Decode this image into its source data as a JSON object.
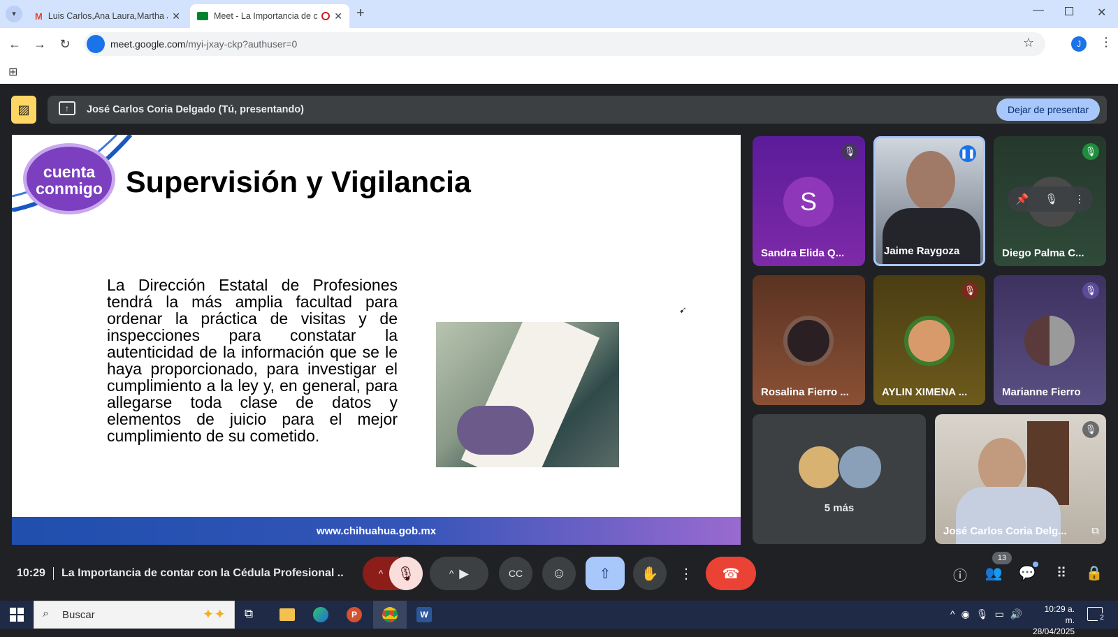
{
  "browser": {
    "tabs": [
      {
        "title": "Luis Carlos,Ana Laura,Martha Ju",
        "active": false
      },
      {
        "title": "Meet - La Importancia de c",
        "active": true
      }
    ],
    "url_host": "meet.google.com",
    "url_path": "/myi-jxay-ckp?authuser=0",
    "profile_initial": "J"
  },
  "presenting": {
    "label": "José Carlos Coria Delgado (Tú, presentando)",
    "stop_button": "Dejar de presentar"
  },
  "slide": {
    "title": "Supervisión y Vigilancia",
    "logo_line1": "cuenta",
    "logo_line2": "conmigo",
    "body": "La Dirección Estatal de Profesiones tendrá la más amplia facultad para ordenar la práctica de visitas y de inspecciones para constatar la autenticidad de la información que se le haya proporcionado, para investigar el cumplimiento a la ley y, en general, para allegarse toda clase de datos y elementos de juicio para el mejor cumplimiento de su cometido.",
    "footer_url": "www.chihuahua.gob.mx"
  },
  "participants": [
    {
      "name": "Sandra Elida Q...",
      "initial": "S"
    },
    {
      "name": "Jaime Raygoza"
    },
    {
      "name": "Diego Palma C..."
    },
    {
      "name": "Rosalina Fierro ..."
    },
    {
      "name": "AYLIN XIMENA ..."
    },
    {
      "name": "Marianne Fierro"
    },
    {
      "name": "José Carlos Coria Delg..."
    }
  ],
  "more_participants": "5 más",
  "meeting": {
    "time": "10:29",
    "title": "La Importancia de contar con la Cédula Profesional ...",
    "people_count": "13"
  },
  "taskbar": {
    "search_placeholder": "Buscar",
    "clock_time": "10:29 a. m.",
    "clock_date": "28/04/2025",
    "notifications": "2"
  },
  "colors": {
    "meet_bg": "#202124",
    "accent_blue": "#a8c7fa",
    "end_call_red": "#ea4335",
    "mic_off_red": "#f9dedc",
    "logo_purple": "#7b3fbf"
  }
}
